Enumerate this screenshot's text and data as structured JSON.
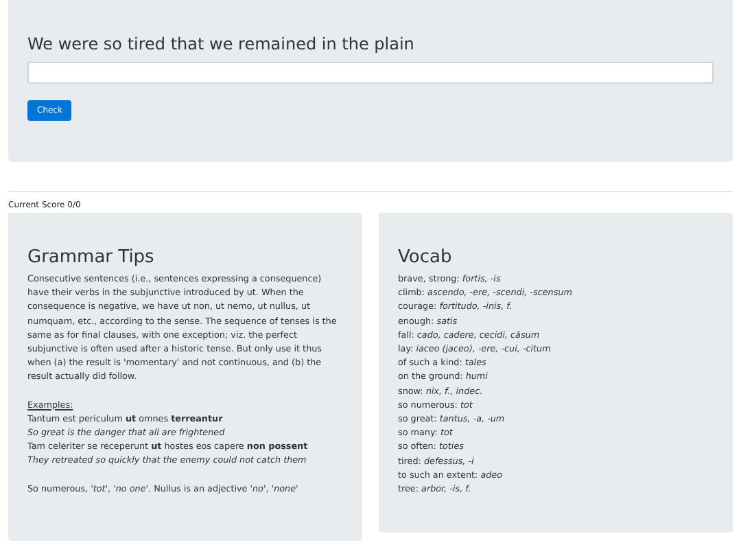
{
  "exercise": {
    "prompt": "We were so tired that we remained in the plain",
    "button": "Check"
  },
  "score": "Current Score 0/0",
  "grammar": {
    "title": "Grammar Tips",
    "text": "Consecutive sentences (i.e., sentences expressing a consequence) have their verbs in the subjunctive introduced by ut. When the consequence is negative, we have ut non, ut nemo, ut nullus, ut numquam, etc., according to the sense. The sequence of tenses is the same as for final clauses, with one exception; viz. the perfect subjunctive is often used after a historic tense. But only use it thus when (a) the result is 'momentary' and not continuous, and (b) the result actually did follow.",
    "examples_label": "Examples:",
    "examples": [
      {
        "kind": "latin",
        "text": "Tantum est periculum **ut** omnes **terreantur**"
      },
      {
        "kind": "translation",
        "text": "So great is the danger that all are frightened"
      },
      {
        "kind": "latin",
        "text": "Tam celeriter se receperunt **ut** hostes eos capere **non possent**"
      },
      {
        "kind": "translation",
        "text": "They retreated so quickly that the enemy could not catch them"
      }
    ],
    "note": "So numerous, *'tot'*, *'no one'*. Nullus is an adjective *'no'*, *'none'*"
  },
  "vocab": {
    "title": "Vocab",
    "entries": [
      "brave, strong: *fortis, -is*",
      "climb: *ascendo, -ere, -scendi, -scensum*",
      "courage: *fortitudo, -inis, f.*",
      "enough: *satis*",
      "fall: *cado, cadere, cecidi, cāsum*",
      "lay: *iaceo (jaceo), -ere, -cui, -citum*",
      "of such a kind: *tales*",
      "on the ground: *humi*",
      "snow: *nix, f., indec.*",
      "so numerous: *tot*",
      "so great: *tantus, -a, -um*",
      "so many: *tot*",
      "so often: *toties*",
      "tired: *defessus, -i*",
      "to such an extent: *adeo*",
      "tree: *arbor, -is, f.*"
    ]
  }
}
